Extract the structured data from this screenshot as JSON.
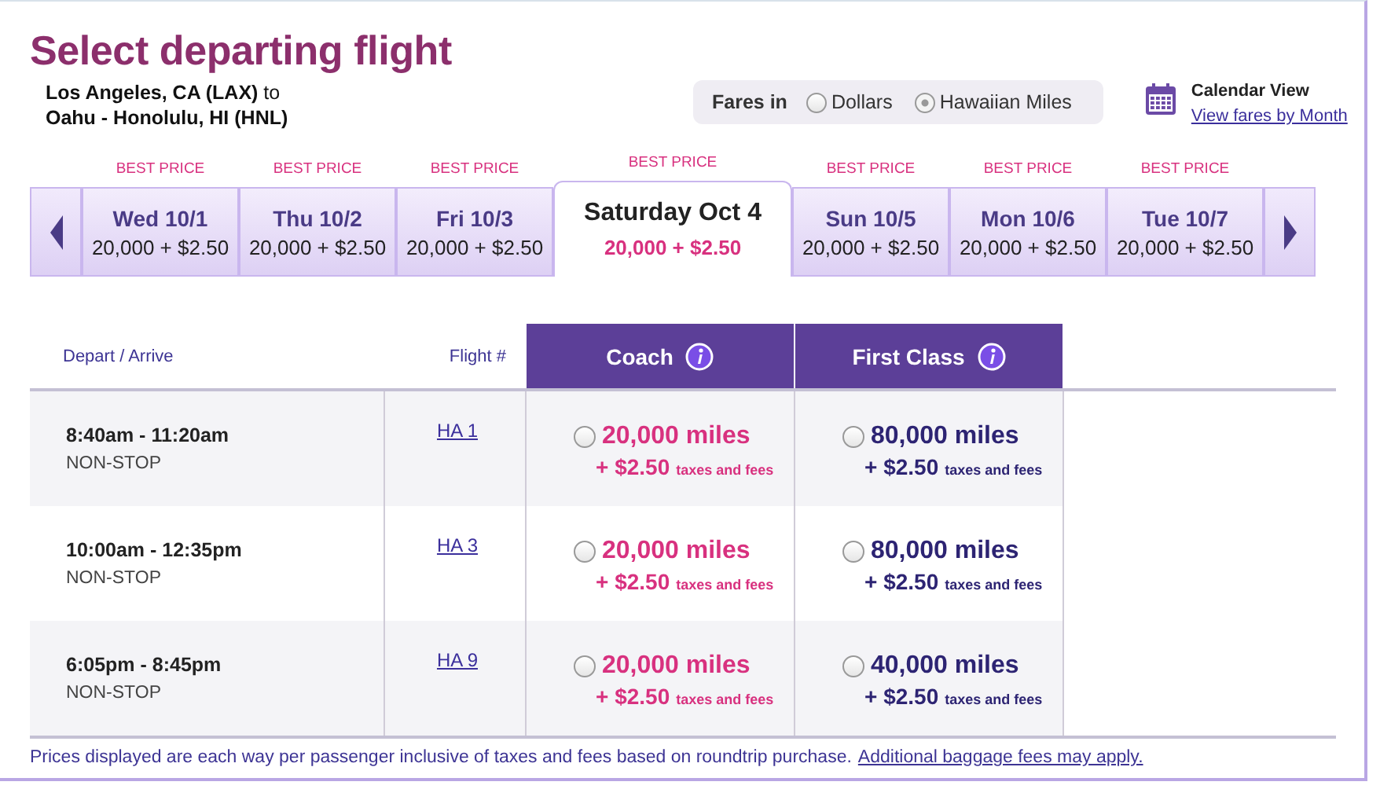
{
  "title": "Select departing flight",
  "route": [
    "**Los Angeles, CA (LAX)** to",
    "**Oahu - Honolulu, HI (HNL)**"
  ],
  "fares_in": {
    "label": "Fares in",
    "options": [
      {
        "label": "Dollars",
        "selected": false
      },
      {
        "label": "Hawaiian Miles",
        "selected": true
      }
    ]
  },
  "calendar": {
    "title": "Calendar View",
    "link": "View fares by Month"
  },
  "dates": [
    {
      "badge": "BEST PRICE",
      "day": "Wed 10/1",
      "price": "20,000 + $2.50",
      "selected": false
    },
    {
      "badge": "BEST PRICE",
      "day": "Thu 10/2",
      "price": "20,000 + $2.50",
      "selected": false
    },
    {
      "badge": "BEST PRICE",
      "day": "Fri 10/3",
      "price": "20,000 + $2.50",
      "selected": false
    },
    {
      "badge": "BEST PRICE",
      "day": "Saturday Oct 4",
      "price": "20,000 + $2.50",
      "selected": true
    },
    {
      "badge": "BEST PRICE",
      "day": "Sun 10/5",
      "price": "20,000 + $2.50",
      "selected": false
    },
    {
      "badge": "BEST PRICE",
      "day": "Mon 10/6",
      "price": "20,000 + $2.50",
      "selected": false
    },
    {
      "badge": "BEST PRICE",
      "day": "Tue 10/7",
      "price": "20,000 + $2.50",
      "selected": false
    }
  ],
  "table": {
    "columns": [
      "Depart / Arrive",
      "Flight #"
    ],
    "classes": [
      "Coach",
      "First Class"
    ],
    "rows": [
      {
        "times": "8:40am - 11:20am",
        "stops": "NON-STOP",
        "flight": "HA 1",
        "fares": [
          {
            "miles": "20,000 miles",
            "fee": "+ $2.50",
            "fee_note": "taxes and fees",
            "selected": false
          },
          {
            "miles": "80,000 miles",
            "fee": "+ $2.50",
            "fee_note": "taxes and fees",
            "selected": false
          }
        ]
      },
      {
        "times": "10:00am - 12:35pm",
        "stops": "NON-STOP",
        "flight": "HA 3",
        "fares": [
          {
            "miles": "20,000 miles",
            "fee": "+ $2.50",
            "fee_note": "taxes and fees",
            "selected": false
          },
          {
            "miles": "80,000 miles",
            "fee": "+ $2.50",
            "fee_note": "taxes and fees",
            "selected": false
          }
        ]
      },
      {
        "times": "6:05pm - 8:45pm",
        "stops": "NON-STOP",
        "flight": "HA 9",
        "fares": [
          {
            "miles": "20,000 miles",
            "fee": "+ $2.50",
            "fee_note": "taxes and fees",
            "selected": false
          },
          {
            "miles": "40,000 miles",
            "fee": "+ $2.50",
            "fee_note": "taxes and fees",
            "selected": false
          }
        ]
      }
    ]
  },
  "footer": {
    "text": "Prices displayed are each way per passenger inclusive of taxes and fees based on roundtrip purchase.",
    "link": "Additional baggage fees may apply."
  }
}
